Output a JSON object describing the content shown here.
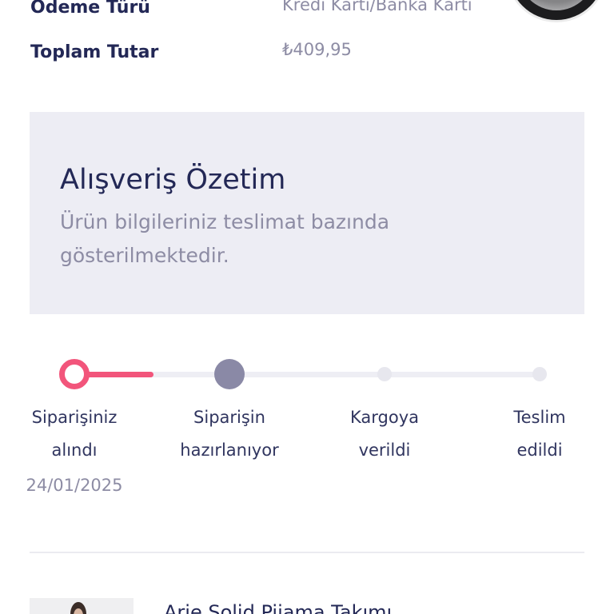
{
  "order_info": {
    "payment_type": {
      "label": "Ödeme Türü",
      "value": "Kredi Kartı/Banka Kartı"
    },
    "total": {
      "label": "Toplam Tutar",
      "value": "₺409,95"
    }
  },
  "summary": {
    "title": "Alışveriş Özetim",
    "subtitle": "Ürün bilgileriniz teslimat bazında gösterilmektedir."
  },
  "tracker": {
    "progress_fraction": 0.17,
    "steps": [
      {
        "label": [
          "Siparişiniz",
          "alındı"
        ],
        "date": "24/01/2025",
        "status": "completed"
      },
      {
        "label": [
          "Siparişin",
          "hazırlanıyor"
        ],
        "status": "in-progress"
      },
      {
        "label": [
          "Kargoya",
          "verildi"
        ],
        "status": "pending"
      },
      {
        "label": [
          "Teslim",
          "edildi"
        ],
        "status": "pending"
      }
    ]
  },
  "product": {
    "name": "Arie Solid Pijama Takımı"
  },
  "colors": {
    "accent": "#F2557B",
    "heading": "#232856",
    "label": "#30355F",
    "muted_text": "#8D8CA4",
    "summary_background": "#EDEDF4",
    "step_active": "#8A89A6",
    "step_pending": "#E7E7EE",
    "track": "#EEEEF4"
  }
}
